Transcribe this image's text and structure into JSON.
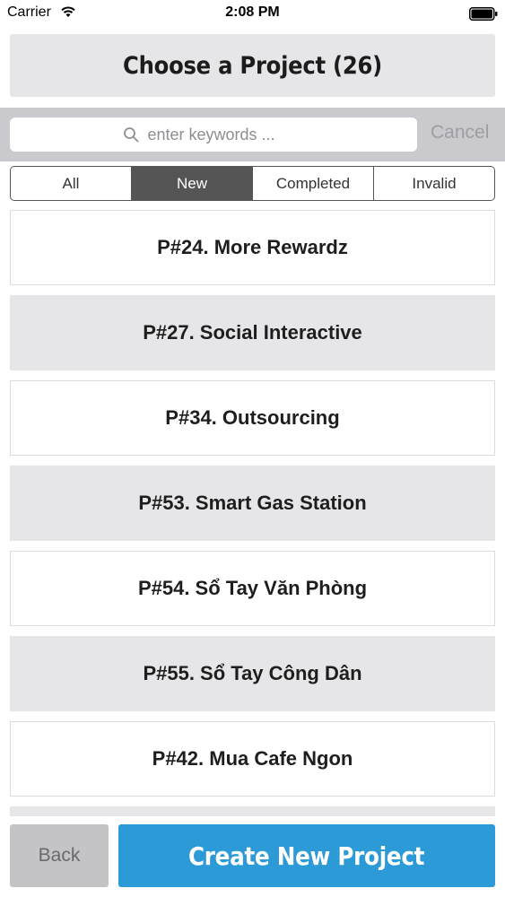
{
  "status_bar": {
    "carrier": "Carrier",
    "time": "2:08 PM",
    "wifi_icon": "wifi-icon",
    "battery_icon": "battery-icon"
  },
  "header": {
    "title": "Choose a Project (26)"
  },
  "search": {
    "placeholder": "enter keywords ...",
    "value": "",
    "cancel_label": "Cancel",
    "icon": "search-icon"
  },
  "filters": {
    "selected": "New",
    "tabs": [
      {
        "label": "All"
      },
      {
        "label": "New"
      },
      {
        "label": "Completed"
      },
      {
        "label": "Invalid"
      }
    ]
  },
  "projects": [
    {
      "label": "P#24. More Rewardz"
    },
    {
      "label": "P#27. Social Interactive"
    },
    {
      "label": "P#34. Outsourcing"
    },
    {
      "label": "P#53. Smart Gas Station"
    },
    {
      "label": "P#54. Sổ Tay Văn Phòng"
    },
    {
      "label": "P#55. Sổ Tay Công Dân"
    },
    {
      "label": "P#42. Mua Cafe Ngon"
    }
  ],
  "footer": {
    "back_label": "Back",
    "create_label": "Create New Project"
  },
  "colors": {
    "accent": "#2b9ad6",
    "segment_active": "#555555",
    "row_alt": "#e6e6e9",
    "search_bar": "#c9c9ce"
  }
}
